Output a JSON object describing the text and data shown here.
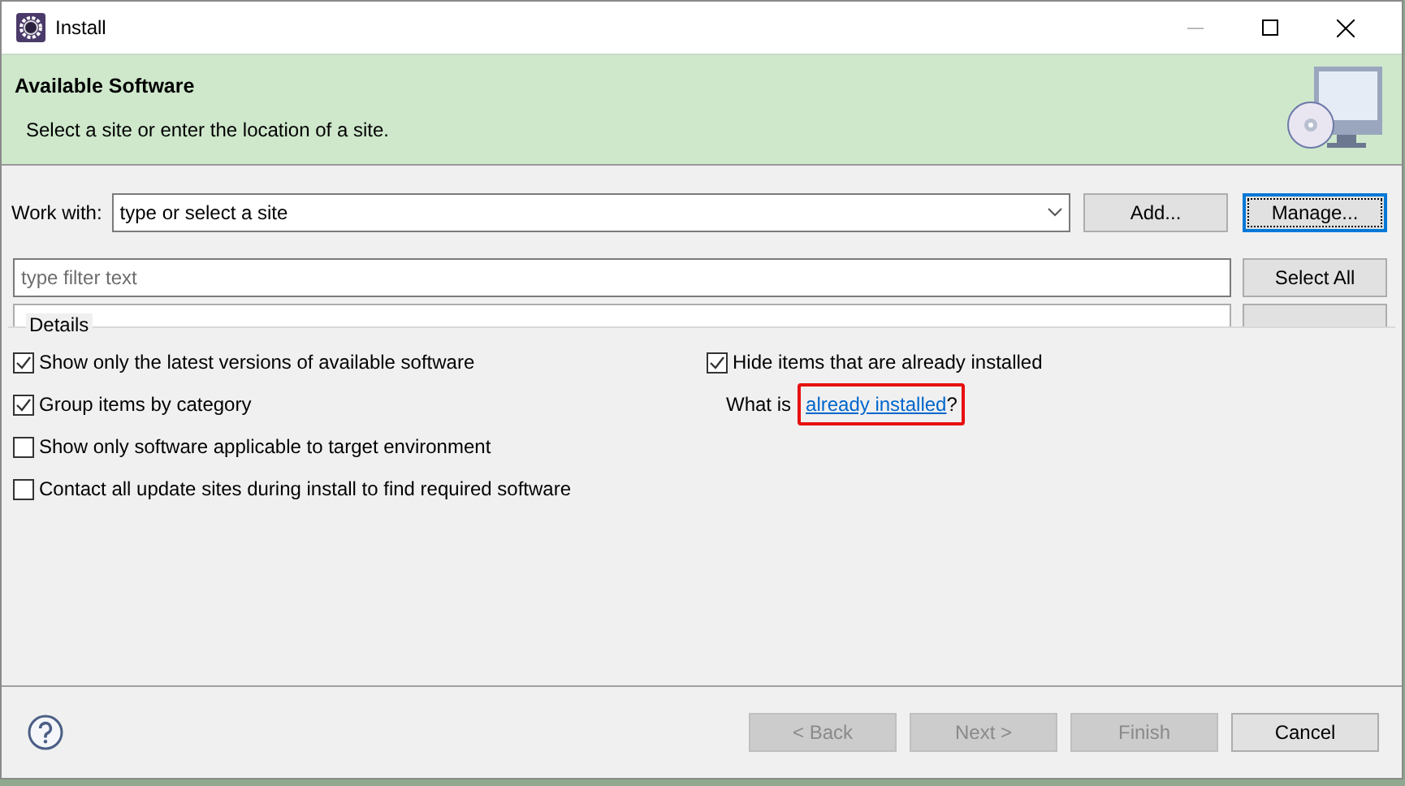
{
  "window": {
    "title": "Install"
  },
  "banner": {
    "title": "Available Software",
    "description": "Select a site or enter the location of a site."
  },
  "work_with": {
    "label": "Work with:",
    "value": "type or select a site"
  },
  "site_buttons": [
    {
      "label": "Add...",
      "focused": false
    },
    {
      "label": "Manage...",
      "focused": true
    }
  ],
  "filter": {
    "placeholder": "type filter text"
  },
  "select_all": {
    "label": "Select All"
  },
  "details": {
    "legend": "Details",
    "left_options": [
      {
        "label": "Show only the latest versions of available software",
        "checked": true
      },
      {
        "label": "Group items by category",
        "checked": true
      },
      {
        "label": "Show only software applicable to target environment",
        "checked": false
      },
      {
        "label": "Contact all update sites during install to find required software",
        "checked": false
      }
    ],
    "right_options": [
      {
        "label": "Hide items that are already installed",
        "checked": true
      }
    ],
    "what_is": {
      "prefix": "What is",
      "link": "already installed",
      "suffix": "?"
    }
  },
  "footer_buttons": [
    {
      "label": "< Back",
      "disabled": true
    },
    {
      "label": "Next >",
      "disabled": true
    },
    {
      "label": "Finish",
      "disabled": true
    },
    {
      "label": "Cancel",
      "disabled": false
    }
  ]
}
